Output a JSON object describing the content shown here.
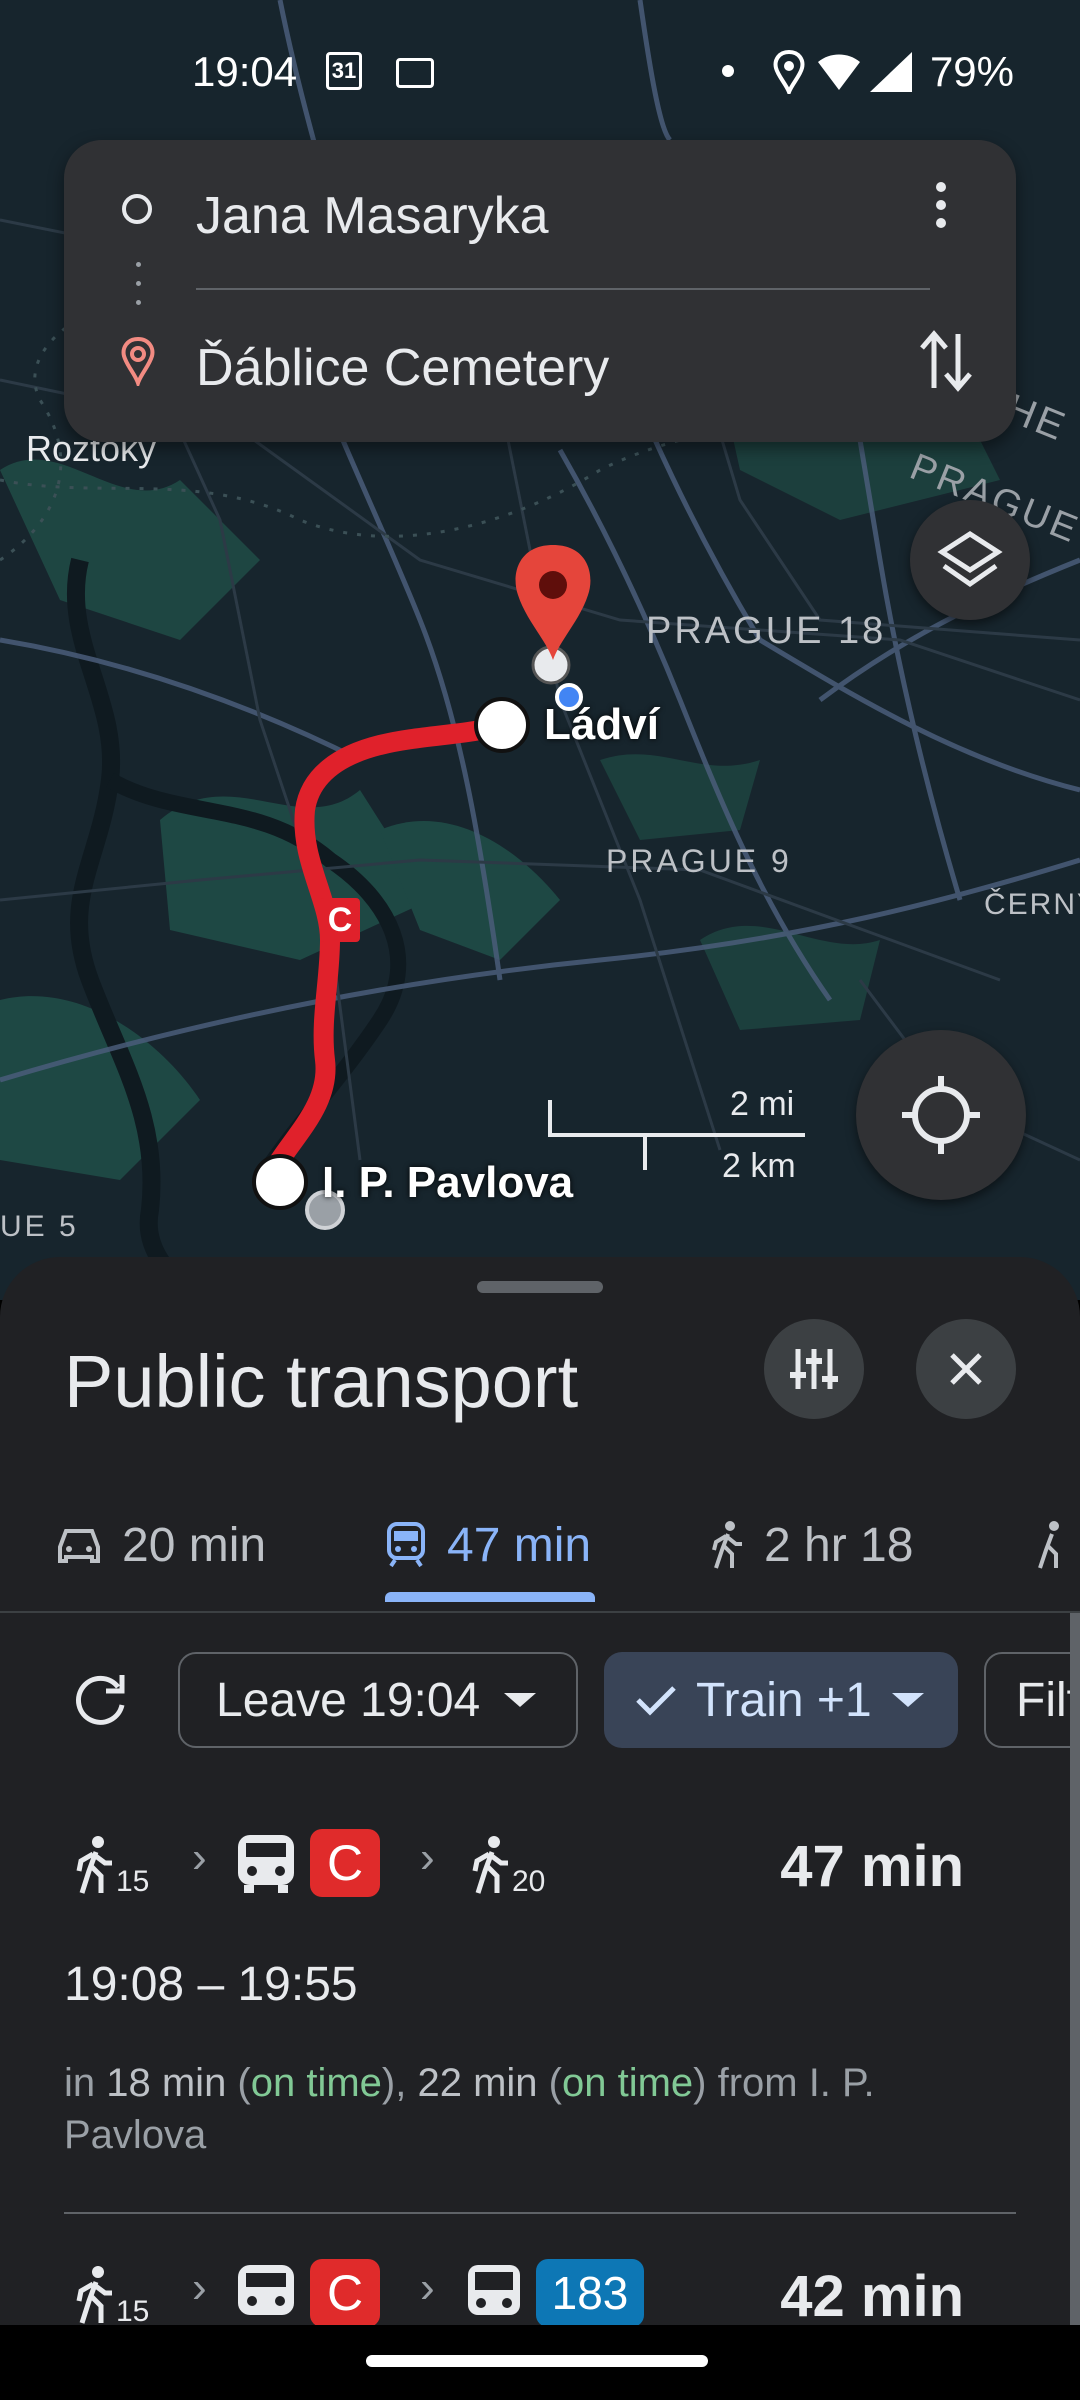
{
  "status_bar": {
    "time": "19:04",
    "calendar_day": "31",
    "battery": "79%"
  },
  "directions": {
    "origin": "Jana Masaryka",
    "destination": "Ďáblice Cemetery"
  },
  "map": {
    "labels": {
      "roztoky": "Roztoky",
      "prague18": "PRAGUE 18",
      "prague9": "PRAGUE 9",
      "cerny": "ČERNÝ",
      "prague_corner": "PRAGUE",
      "he_corner": "HE",
      "ue5": "UE 5",
      "ladvi": "Ládví",
      "pavlova": "I. P. Pavlova",
      "line_badge": "C"
    },
    "scale": {
      "miles": "2 mi",
      "km": "2 km"
    }
  },
  "sheet": {
    "title": "Public transport",
    "tabs": [
      {
        "label": "20 min",
        "icon": "car-icon"
      },
      {
        "label": "47 min",
        "icon": "train-icon"
      },
      {
        "label": "2 hr 18",
        "icon": "walk-icon"
      }
    ],
    "chips": {
      "leave": "Leave 19:04",
      "train": "Train +1",
      "filter": "Filt"
    },
    "routes": [
      {
        "walk_start": "15",
        "line": "C",
        "walk_end": "20",
        "duration": "47 min",
        "times": "19:08 – 19:55",
        "info": {
          "prefix": "in ",
          "min1": "18 min",
          "status1": "on time",
          "min2": "22 min",
          "status2": "on time",
          "suffix": " from I. P. Pavlova"
        }
      },
      {
        "walk_start": "15",
        "line": "C",
        "bus": "183",
        "duration": "42 min"
      }
    ]
  },
  "colors": {
    "accent": "#8ab4f8",
    "metro_c": "#e02b2b",
    "bus": "#0d77b5",
    "on_time": "#81c995"
  }
}
